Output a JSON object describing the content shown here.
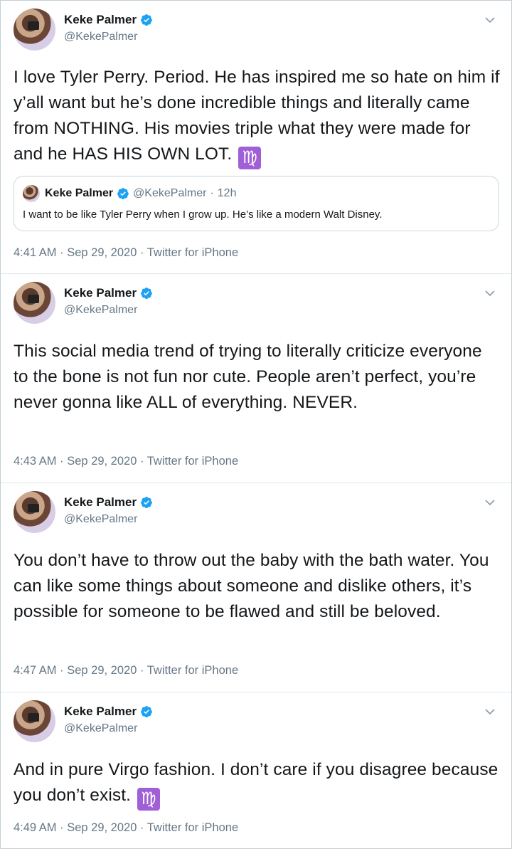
{
  "tweets": [
    {
      "name": "Keke Palmer",
      "handle": "@KekePalmer",
      "text": "I love Tyler Perry. Period. He has inspired me so hate on him if y’all want but he’s done incredible things and literally came from NOTHING. His movies triple what they were made for and he HAS HIS OWN LOT.",
      "emoji": "♍",
      "quoted": {
        "name": "Keke Palmer",
        "handle": "@KekePalmer",
        "time": "12h",
        "text": "I want to be like Tyler Perry when I grow up. He’s like a modern Walt Disney."
      },
      "meta": "4:41 AM · Sep 29, 2020 · Twitter for iPhone"
    },
    {
      "name": "Keke Palmer",
      "handle": "@KekePalmer",
      "text": "This social media trend of trying to literally criticize everyone to the bone is not fun nor cute. People aren’t perfect, you’re never gonna like ALL of everything. NEVER.",
      "meta": "4:43 AM · Sep 29, 2020 · Twitter for iPhone"
    },
    {
      "name": "Keke Palmer",
      "handle": "@KekePalmer",
      "text": "You don’t have to throw out the baby with the bath water. You can like some things about someone and dislike others, it’s possible for someone to be flawed and still be beloved.",
      "meta": "4:47 AM · Sep 29, 2020 · Twitter for iPhone"
    },
    {
      "name": "Keke Palmer",
      "handle": "@KekePalmer",
      "text": "And in pure Virgo fashion. I don’t care if you disagree because you don’t exist.",
      "emoji": "♍",
      "meta": "4:49 AM · Sep 29, 2020 · Twitter for iPhone"
    }
  ],
  "colors": {
    "verified": "#1da1f2",
    "virgo_bg": "#a05fd6",
    "secondary_text": "#657786"
  },
  "icons": {
    "verified": "verified-badge-icon",
    "more": "chevron-down-icon"
  }
}
